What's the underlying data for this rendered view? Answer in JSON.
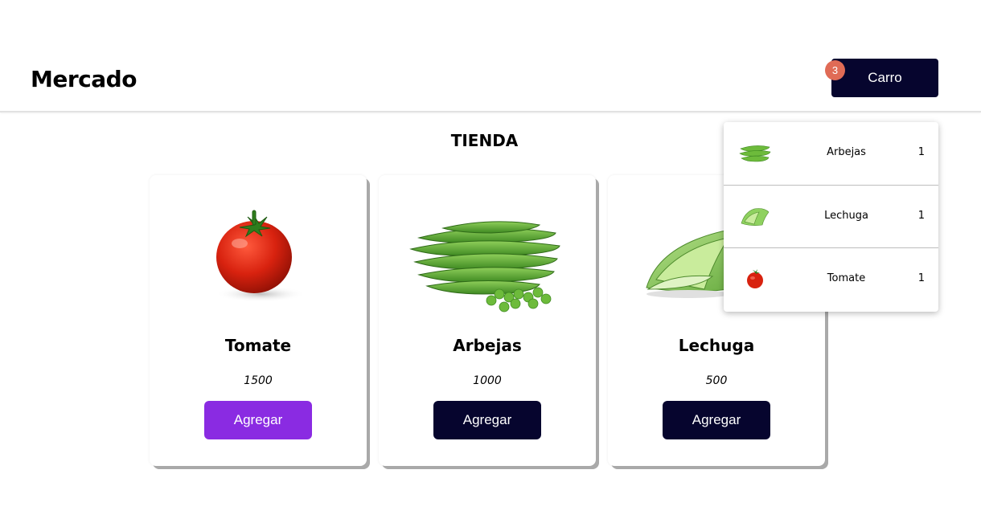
{
  "header": {
    "brand": "Mercado",
    "cart_label": "Carro",
    "cart_count": "3",
    "cart_color": "#06052e",
    "badge_color": "#e06b56"
  },
  "store": {
    "title": "TIENDA",
    "products": [
      {
        "name": "Tomate",
        "price": "1500",
        "button": "Agregar",
        "icon": "tomato-image",
        "button_color": "#8a2be2"
      },
      {
        "name": "Arbejas",
        "price": "1000",
        "button": "Agregar",
        "icon": "peas-image",
        "button_color": "#06052e"
      },
      {
        "name": "Lechuga",
        "price": "500",
        "button": "Agregar",
        "icon": "lettuce-image",
        "button_color": "#06052e"
      }
    ]
  },
  "cart": {
    "items": [
      {
        "name": "Arbejas",
        "qty": "1",
        "icon": "peas-thumbnail"
      },
      {
        "name": "Lechuga",
        "qty": "1",
        "icon": "lettuce-thumbnail"
      },
      {
        "name": "Tomate",
        "qty": "1",
        "icon": "tomato-thumbnail"
      }
    ]
  }
}
